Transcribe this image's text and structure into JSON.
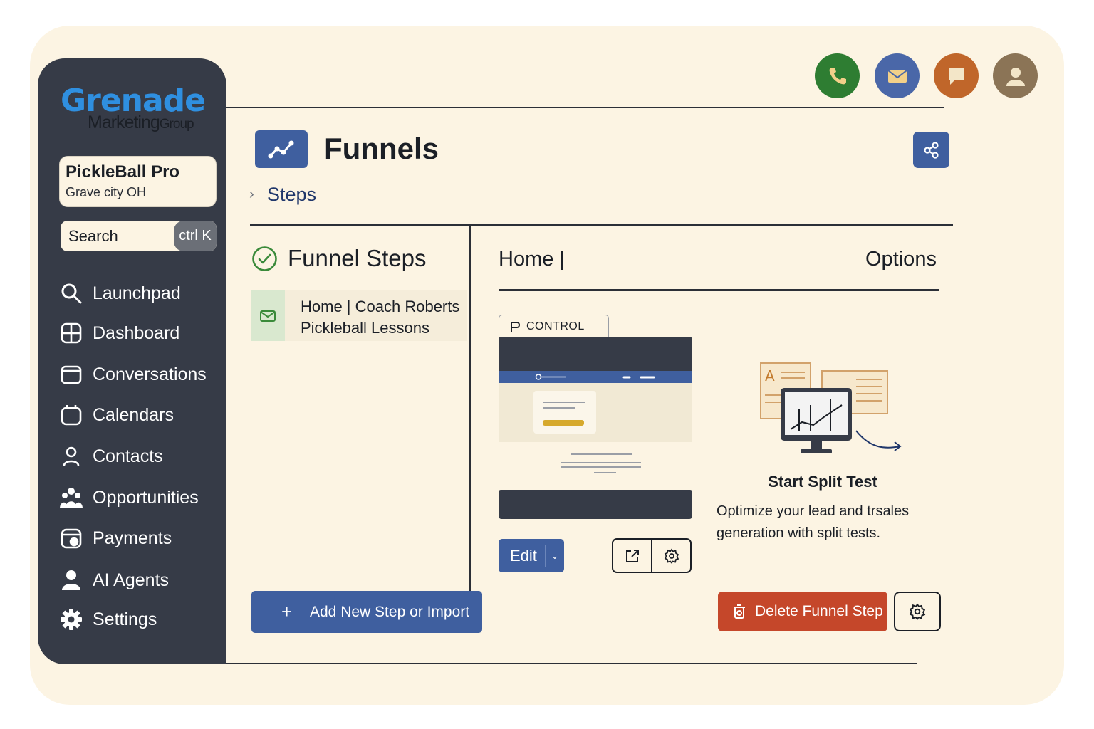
{
  "brand": {
    "logo_top": "Grenade",
    "logo_bottom_main": "Marketing",
    "logo_bottom_small": "Group"
  },
  "account": {
    "name": "PickleBall Pro",
    "location": "Grave city OH"
  },
  "search": {
    "label": "Search",
    "shortcut": "ctrl K"
  },
  "sidebar": {
    "items": [
      {
        "label": "Launchpad",
        "icon": "search-icon"
      },
      {
        "label": "Dashboard",
        "icon": "dashboard-icon"
      },
      {
        "label": "Conversations",
        "icon": "chat-icon"
      },
      {
        "label": "Calendars",
        "icon": "calendar-icon"
      },
      {
        "label": "Contacts",
        "icon": "contact-icon"
      },
      {
        "label": "Opportunities",
        "icon": "people-icon"
      },
      {
        "label": "Payments",
        "icon": "payments-icon"
      },
      {
        "label": "AI Agents",
        "icon": "user-icon"
      },
      {
        "label": "Settings",
        "icon": "gear-icon"
      }
    ]
  },
  "topbar": {
    "buttons": [
      {
        "icon": "phone-icon",
        "color": "#2e7d32"
      },
      {
        "icon": "mail-icon",
        "color": "#4a67a8"
      },
      {
        "icon": "chat-bubble-icon",
        "color": "#c0662a"
      },
      {
        "icon": "avatar-icon",
        "color": "#8b7456"
      }
    ]
  },
  "header": {
    "title": "Funnels",
    "breadcrumb": "Steps"
  },
  "steps_panel": {
    "heading": "Funnel Steps",
    "steps": [
      {
        "line1": "Home | Coach Roberts",
        "line2": "Pickleball Lessons"
      }
    ],
    "add_button": "Add New Step or Import"
  },
  "detail": {
    "title": "Home |",
    "options": "Options",
    "control_label": "CONTROL",
    "edit_label": "Edit",
    "split_test_title": "Start Split Test",
    "split_test_desc": "Optimize your lead and trsales generation with split tests.",
    "delete_label": "Delete Funnel Step"
  },
  "colors": {
    "background": "#fcf4e3",
    "sidebar": "#363b47",
    "primary": "#3f5f9f",
    "danger": "#c5472a",
    "accent_logo": "#2f8fe0"
  }
}
